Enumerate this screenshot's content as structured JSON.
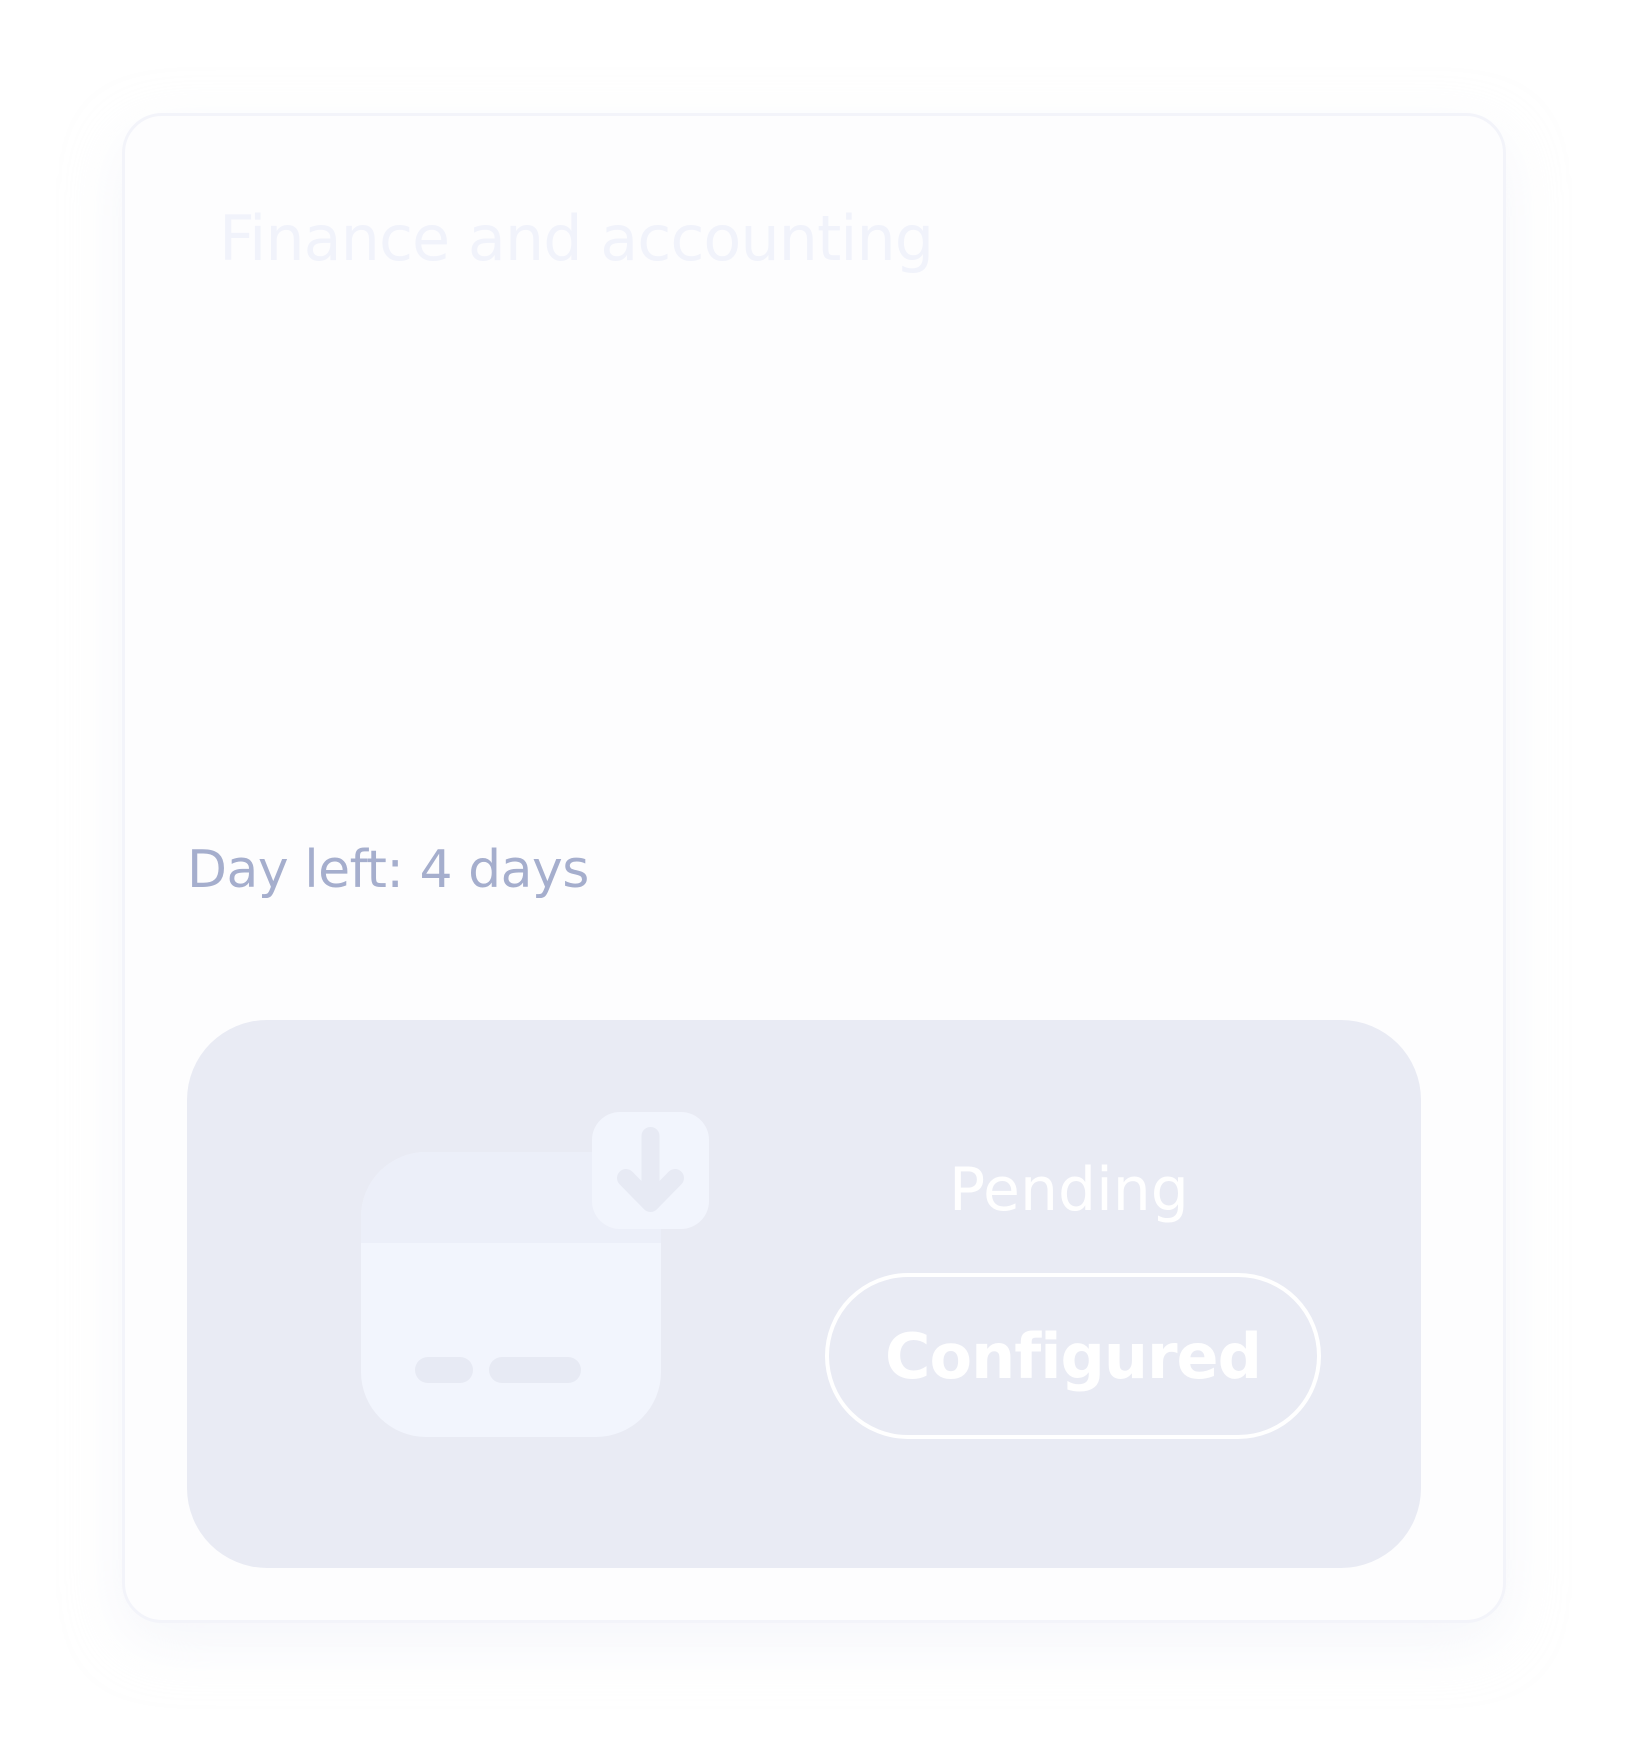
{
  "card": {
    "title": "Finance and accounting",
    "days_left": "Day left: 4 days"
  },
  "status": {
    "icon": "credit-card-download-icon",
    "label": "Pending",
    "button_label": "Configured"
  },
  "colors": {
    "panel_background": "#e9ebf4",
    "icon_fill": "#f2f5fd",
    "muted_text": "#a5aecd",
    "title_text": "#f1f3fb",
    "white": "#ffffff"
  }
}
